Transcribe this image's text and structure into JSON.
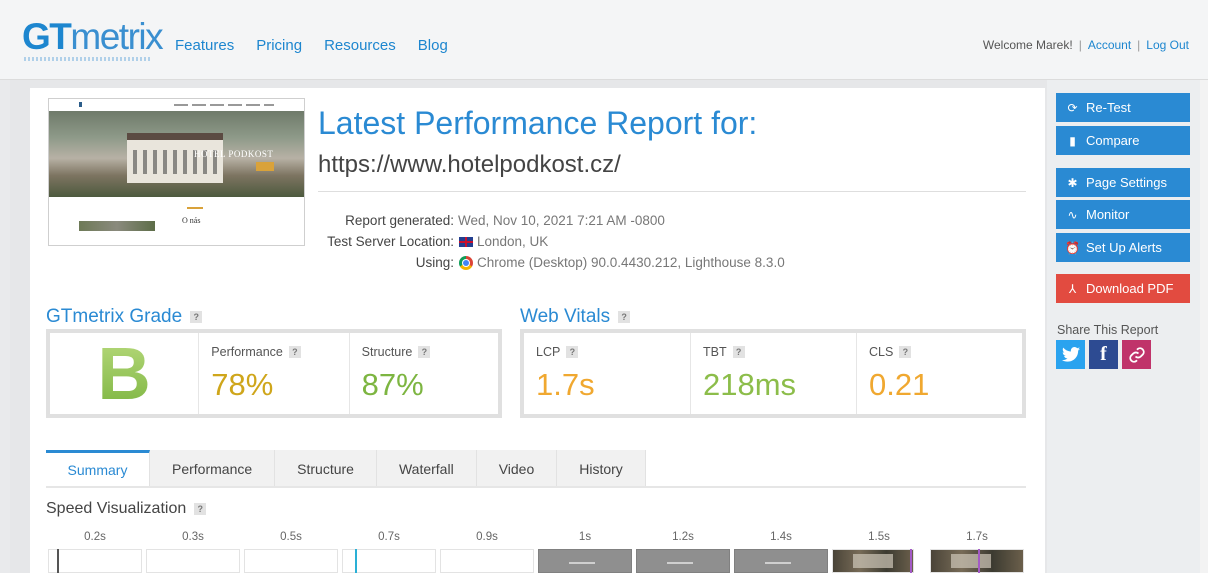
{
  "header": {
    "logo": {
      "bold": "GT",
      "light": "metrix"
    },
    "nav": [
      "Features",
      "Pricing",
      "Resources",
      "Blog"
    ],
    "welcome": "Welcome Marek!",
    "account": "Account",
    "logout": "Log Out"
  },
  "thumbnail": {
    "hotel_text": "HOTEL PODKOST",
    "section_text": "O nás"
  },
  "report": {
    "title": "Latest Performance Report for:",
    "url": "https://www.hotelpodkost.cz/",
    "meta": [
      {
        "label": "Report generated:",
        "value": "Wed, Nov 10, 2021 7:21 AM -0800",
        "icon": ""
      },
      {
        "label": "Test Server Location:",
        "value": "London, UK",
        "icon": "uk-flag-icon"
      },
      {
        "label": "Using:",
        "value": "Chrome (Desktop) 90.0.4430.212, Lighthouse 8.3.0",
        "icon": "chrome-icon"
      }
    ]
  },
  "grade": {
    "title": "GTmetrix Grade",
    "help": "?",
    "letter": "B",
    "metrics": [
      {
        "label": "Performance",
        "value": "78%",
        "color": "#cfa61b"
      },
      {
        "label": "Structure",
        "value": "87%",
        "color": "#7db541"
      }
    ]
  },
  "vitals": {
    "title": "Web Vitals",
    "help": "?",
    "metrics": [
      {
        "label": "LCP",
        "value": "1.7s",
        "color": "#f0a830"
      },
      {
        "label": "TBT",
        "value": "218ms",
        "color": "#8cbd4a"
      },
      {
        "label": "CLS",
        "value": "0.21",
        "color": "#f0a830"
      }
    ]
  },
  "tabs": [
    "Summary",
    "Performance",
    "Structure",
    "Waterfall",
    "Video",
    "History"
  ],
  "active_tab": "Summary",
  "speed": {
    "title": "Speed Visualization",
    "help": "?",
    "ticks": [
      "0.2s",
      "0.3s",
      "0.5s",
      "0.7s",
      "0.9s",
      "1s",
      "1.2s",
      "1.4s",
      "1.5s",
      "1.7s"
    ]
  },
  "sidebar": {
    "buttons": [
      {
        "label": "Re-Test",
        "icon": "refresh-icon"
      },
      {
        "label": "Compare",
        "icon": "compare-icon"
      },
      {
        "label": "Page Settings",
        "icon": "gear-icon"
      },
      {
        "label": "Monitor",
        "icon": "pulse-icon"
      },
      {
        "label": "Set Up Alerts",
        "icon": "alarm-icon"
      },
      {
        "label": "Download PDF",
        "icon": "pdf-icon"
      }
    ],
    "share_title": "Share This Report"
  },
  "colors": {
    "accent": "#2a8ad3",
    "danger": "#e24b40"
  }
}
